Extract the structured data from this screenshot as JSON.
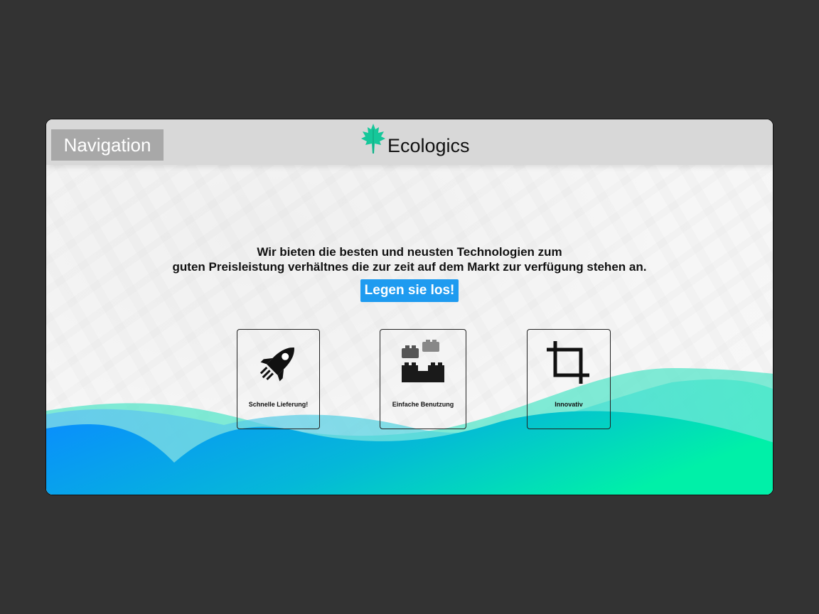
{
  "header": {
    "nav_label": "Navigation",
    "brand_name": "Ecologics",
    "brand_logo_icon": "maple-leaf-icon",
    "brand_color": "#16c79a"
  },
  "hero": {
    "line1": "Wir bieten die besten und neusten Technologien zum",
    "line2": "guten Preisleistung verhältnes die zur zeit auf dem Markt zur verfügung stehen an.",
    "cta_label": "Legen sie los!",
    "cta_color": "#1e9bf0"
  },
  "features": [
    {
      "label": "Schnelle Lieferung!",
      "icon": "rocket-icon"
    },
    {
      "label": "Einfache Benutzung",
      "icon": "blocks-icon"
    },
    {
      "label": "Innovativ",
      "icon": "crop-icon"
    }
  ],
  "colors": {
    "wave_start": "#0a8cff",
    "wave_end": "#00f0a8",
    "background": "#333333"
  }
}
